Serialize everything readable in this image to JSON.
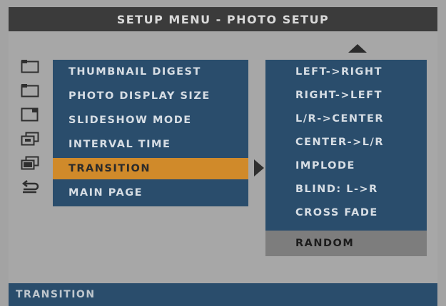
{
  "title": "SETUP MENU - PHOTO SETUP",
  "menu": {
    "items": [
      {
        "label": "THUMBNAIL DIGEST",
        "icon": "thumbnail-icon"
      },
      {
        "label": "PHOTO DISPLAY SIZE",
        "icon": "display-size-icon"
      },
      {
        "label": "SLIDESHOW MODE",
        "icon": "slideshow-icon"
      },
      {
        "label": "INTERVAL TIME",
        "icon": "interval-icon"
      },
      {
        "label": "TRANSITION",
        "icon": "transition-icon",
        "active": true
      },
      {
        "label": "MAIN PAGE",
        "icon": "return-icon"
      }
    ]
  },
  "submenu": {
    "items": [
      {
        "label": "LEFT->RIGHT"
      },
      {
        "label": "RIGHT->LEFT"
      },
      {
        "label": "L/R->CENTER"
      },
      {
        "label": "CENTER->L/R"
      },
      {
        "label": "IMPLODE"
      },
      {
        "label": "BLIND: L->R"
      },
      {
        "label": "CROSS FADE"
      },
      {
        "label": "RANDOM",
        "selected": true
      }
    ]
  },
  "status": {
    "text": "TRANSITION"
  },
  "colors": {
    "menu_bg": "#2a4d6c",
    "highlight": "#d08a2a",
    "selected": "#7d7d7d",
    "title_bg": "#3b3b3b"
  }
}
